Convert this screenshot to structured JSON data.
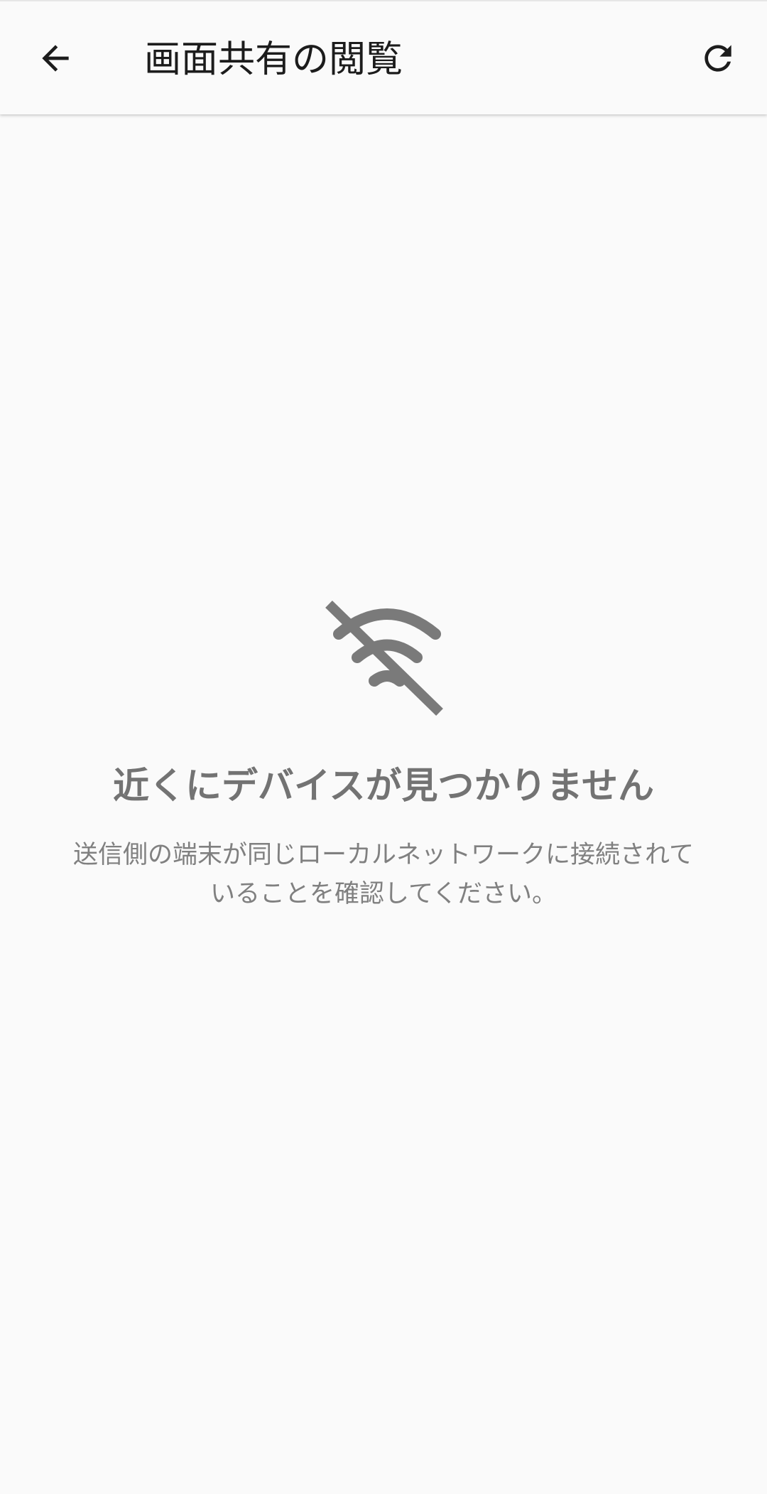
{
  "app_bar": {
    "back_icon": "arrow-left-icon",
    "title": "画面共有の閲覧",
    "refresh_icon": "refresh-icon"
  },
  "empty_state": {
    "icon": "wifi-off-icon",
    "title": "近くにデバイスが見つかりません",
    "description": "送信側の端末が同じローカルネットワークに接続されていることを確認してください。"
  },
  "colors": {
    "background": "#fafafa",
    "title_text": "#1c1c1c",
    "muted_text": "#737373",
    "icon_gray": "#7a7a7a"
  }
}
